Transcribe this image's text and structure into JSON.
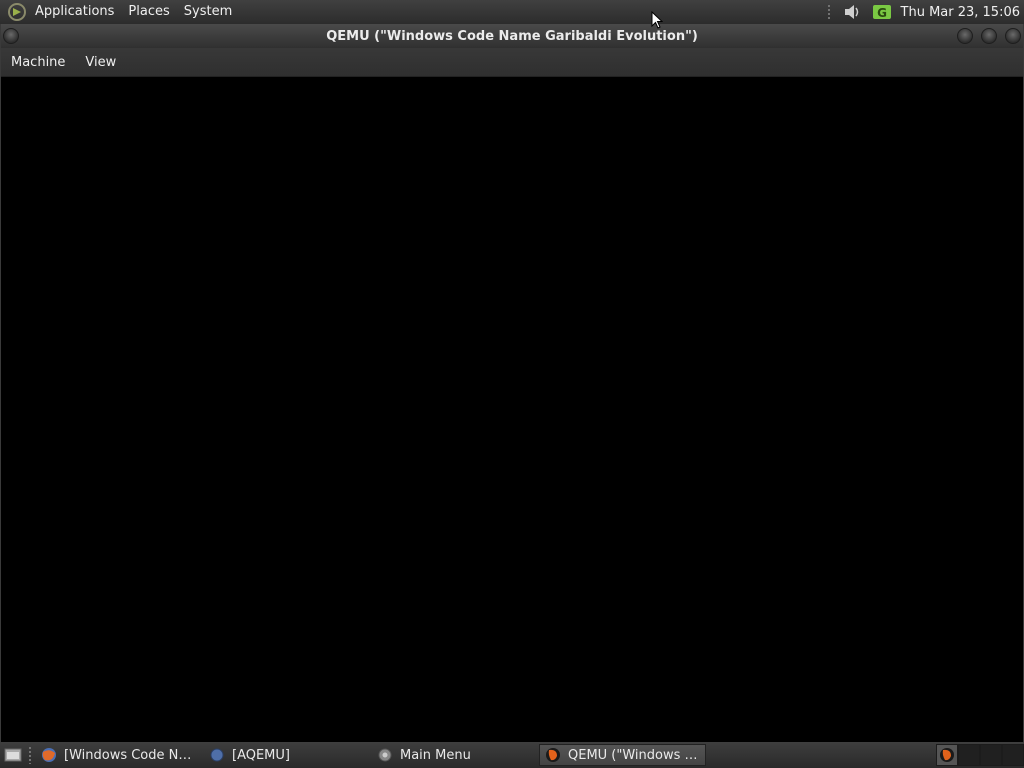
{
  "top_panel": {
    "menus": [
      "Applications",
      "Places",
      "System"
    ],
    "clock": "Thu Mar 23, 15:06"
  },
  "window": {
    "title": "QEMU (\"Windows Code Name Garibaldi Evolution\")",
    "menubar": [
      "Machine",
      "View"
    ]
  },
  "taskbar": {
    "tasks": [
      {
        "label": "[Windows Code Na...",
        "icon": "firefox-icon",
        "active": false
      },
      {
        "label": "[AQEMU]",
        "icon": "aqemu-icon",
        "active": false
      },
      {
        "label": "Main Menu",
        "icon": "main-menu-icon",
        "active": false
      },
      {
        "label": "QEMU (\"Windows C...",
        "icon": "qemu-icon",
        "active": true
      }
    ]
  },
  "colors": {
    "panel": "#333333",
    "desktop": "#000000",
    "accent_green": "#7ac943"
  }
}
